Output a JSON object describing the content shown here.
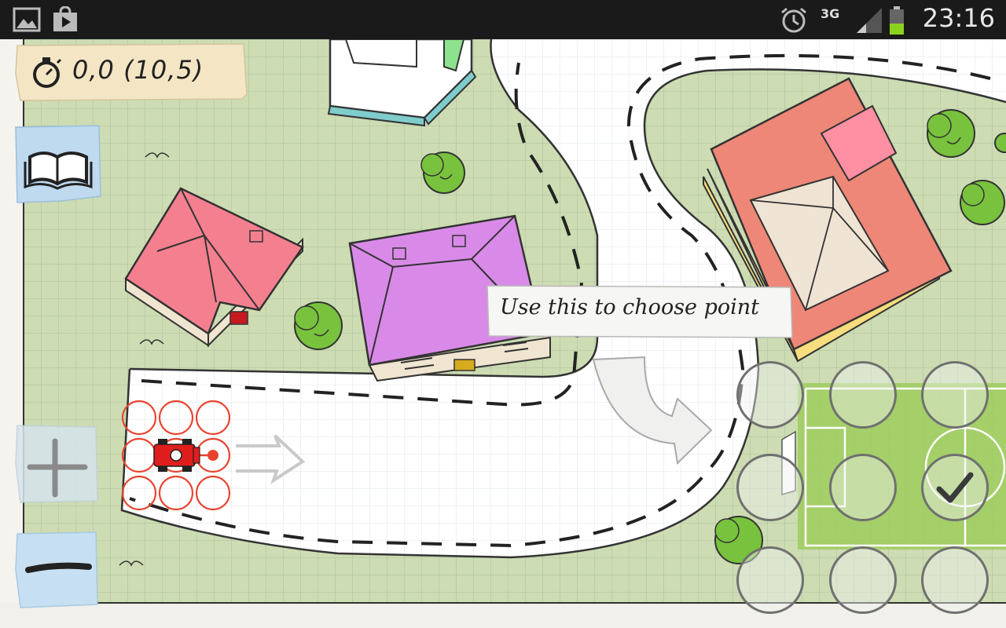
{
  "status_bar": {
    "time": "23:16",
    "network": "3G",
    "icons": [
      "gallery-icon",
      "play-store-icon",
      "alarm-icon",
      "signal-icon",
      "battery-icon"
    ]
  },
  "hud": {
    "timer_icon": "stopwatch-icon",
    "timer_text": "0,0  (10,5)"
  },
  "buttons": {
    "rules_icon": "book-icon",
    "zoom_in_icon": "plus-icon",
    "zoom_out_icon": "minus-icon"
  },
  "tooltip": {
    "text": "Use this to choose point"
  },
  "controls": {
    "grid": "3x3",
    "confirm_icon": "checkmark-icon"
  },
  "colors": {
    "grass": "#cddcb2",
    "road": "#ffffff",
    "car": "#e01d1d",
    "move_option": "#e8432f",
    "pink_roof": "#f4808f",
    "purple_roof": "#d98ae8",
    "red_roof": "#ee8778",
    "field": "#9ccc5c"
  }
}
